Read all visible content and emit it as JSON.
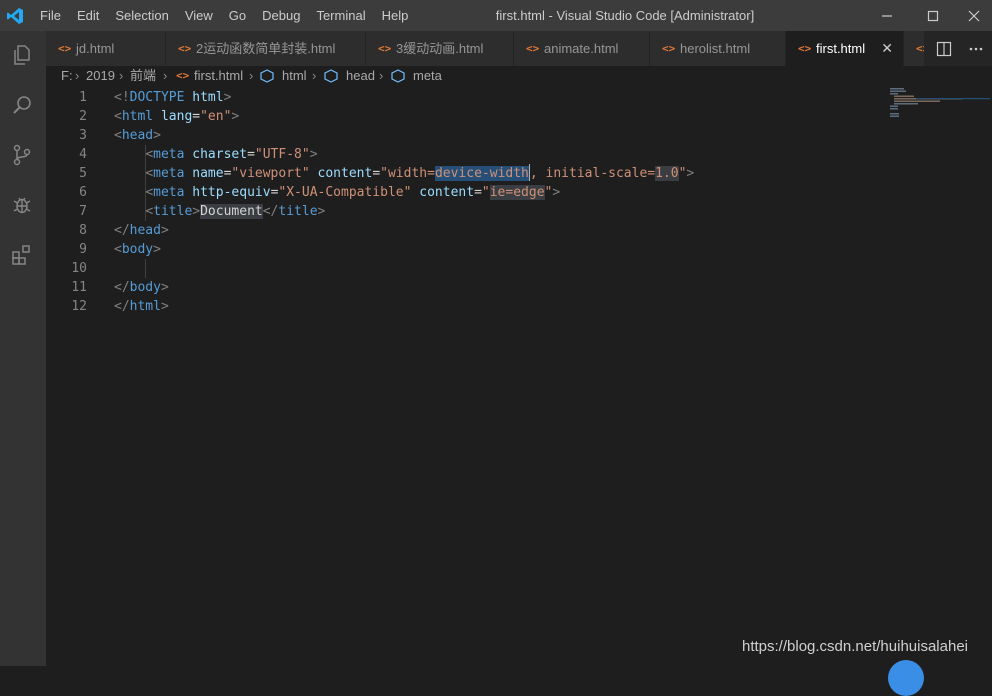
{
  "app": {
    "window_title": "first.html - Visual Studio Code [Administrator]",
    "menu": [
      "File",
      "Edit",
      "Selection",
      "View",
      "Go",
      "Debug",
      "Terminal",
      "Help"
    ]
  },
  "tabs": [
    {
      "label": "jd.html",
      "active": false
    },
    {
      "label": "2运动函数简单封装.html",
      "active": false
    },
    {
      "label": "3缓动动画.html",
      "active": false
    },
    {
      "label": "animate.html",
      "active": false
    },
    {
      "label": "herolist.html",
      "active": false
    },
    {
      "label": "first.html",
      "active": true
    },
    {
      "label": "",
      "active": false
    }
  ],
  "breadcrumb": [
    "F:",
    "2019",
    "前端",
    "first.html",
    "html",
    "head",
    "meta"
  ],
  "editor": {
    "line_numbers": [
      "1",
      "2",
      "3",
      "4",
      "5",
      "6",
      "7",
      "8",
      "9",
      "10",
      "11",
      "12"
    ],
    "lines": [
      [
        [
          "gray",
          "<!"
        ],
        [
          "tag",
          "DOCTYPE"
        ],
        [
          "txt",
          " "
        ],
        [
          "attr",
          "html"
        ],
        [
          "gray",
          ">"
        ]
      ],
      [
        [
          "gray",
          "<"
        ],
        [
          "tag",
          "html"
        ],
        [
          "txt",
          " "
        ],
        [
          "attr",
          "lang"
        ],
        [
          "txt",
          "="
        ],
        [
          "str",
          "\"en\""
        ],
        [
          "gray",
          ">"
        ]
      ],
      [
        [
          "gray",
          "<"
        ],
        [
          "tag",
          "head"
        ],
        [
          "gray",
          ">"
        ]
      ],
      [
        [
          "txt",
          "    "
        ],
        [
          "gray",
          "<"
        ],
        [
          "tag",
          "meta"
        ],
        [
          "txt",
          " "
        ],
        [
          "attr",
          "charset"
        ],
        [
          "txt",
          "="
        ],
        [
          "str",
          "\"UTF-8\""
        ],
        [
          "gray",
          ">"
        ]
      ],
      [
        [
          "txt",
          "    "
        ],
        [
          "gray",
          "<"
        ],
        [
          "tag",
          "meta"
        ],
        [
          "txt",
          " "
        ],
        [
          "attr",
          "name"
        ],
        [
          "txt",
          "="
        ],
        [
          "str",
          "\"viewport\""
        ],
        [
          "txt",
          " "
        ],
        [
          "attr",
          "content"
        ],
        [
          "txt",
          "="
        ],
        [
          "str",
          "\"width="
        ],
        [
          "str-hl",
          "device-width"
        ],
        [
          "cursor",
          ""
        ],
        [
          "str",
          ", initial-scale="
        ],
        [
          "str-hl2",
          "1.0"
        ],
        [
          "str",
          "\""
        ],
        [
          "gray",
          ">"
        ]
      ],
      [
        [
          "txt",
          "    "
        ],
        [
          "gray",
          "<"
        ],
        [
          "tag",
          "meta"
        ],
        [
          "txt",
          " "
        ],
        [
          "attr",
          "http-equiv"
        ],
        [
          "txt",
          "="
        ],
        [
          "str",
          "\"X-UA-Compatible\""
        ],
        [
          "txt",
          " "
        ],
        [
          "attr",
          "content"
        ],
        [
          "txt",
          "="
        ],
        [
          "str",
          "\""
        ],
        [
          "str-hl2",
          "ie=edge"
        ],
        [
          "str",
          "\""
        ],
        [
          "gray",
          ">"
        ]
      ],
      [
        [
          "txt",
          "    "
        ],
        [
          "gray",
          "<"
        ],
        [
          "tag",
          "title"
        ],
        [
          "gray",
          ">"
        ],
        [
          "txt-hl2",
          "Document"
        ],
        [
          "gray",
          "</"
        ],
        [
          "tag",
          "title"
        ],
        [
          "gray",
          ">"
        ]
      ],
      [
        [
          "gray",
          "</"
        ],
        [
          "tag",
          "head"
        ],
        [
          "gray",
          ">"
        ]
      ],
      [
        [
          "gray",
          "<"
        ],
        [
          "tag",
          "body"
        ],
        [
          "gray",
          ">"
        ]
      ],
      [
        [
          "txt",
          ""
        ]
      ],
      [
        [
          "gray",
          "</"
        ],
        [
          "tag",
          "body"
        ],
        [
          "gray",
          ">"
        ]
      ],
      [
        [
          "gray",
          "</"
        ],
        [
          "tag",
          "html"
        ],
        [
          "gray",
          ">"
        ]
      ]
    ]
  },
  "watermark": "https://blog.csdn.net/huihuisalahei",
  "colors": {
    "titlebar": "#3c3c3c",
    "activitybar": "#333333",
    "tabbar": "#252526",
    "editor_bg": "#1e1e1e",
    "vscode_blue": "#23a9f2",
    "html_icon": "#e37933"
  },
  "icons": {
    "activity": [
      "explorer-icon",
      "search-icon",
      "source-control-icon",
      "debug-icon",
      "extensions-icon"
    ],
    "tab_actions": [
      "split-editor-icon",
      "more-actions-icon"
    ],
    "window_controls": [
      "minimize-icon",
      "maximize-icon",
      "close-icon"
    ]
  }
}
